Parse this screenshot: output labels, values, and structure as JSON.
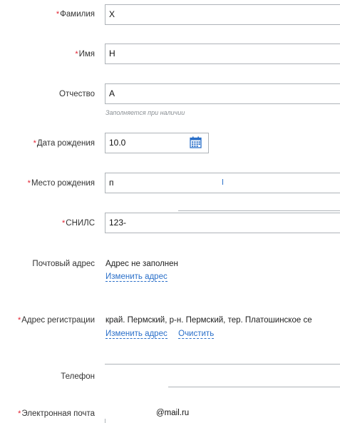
{
  "form": {
    "surname": {
      "label": "Фамилия",
      "required": "*",
      "value": "Х"
    },
    "name": {
      "label": "Имя",
      "required": "*",
      "value": "Н"
    },
    "patronymic": {
      "label": "Отчество",
      "value": "А",
      "hint": "Заполняется при наличии"
    },
    "birth_date": {
      "label": "Дата рождения",
      "required": "*",
      "value": "10.0"
    },
    "birth_place": {
      "label": "Место рождения",
      "required": "*",
      "value": "п"
    },
    "snils": {
      "label": "СНИЛС",
      "required": "*",
      "value": "123-"
    },
    "postal_address": {
      "label": "Почтовый адрес",
      "value": "Адрес не заполнен",
      "change_link": "Изменить адрес"
    },
    "registration_address": {
      "label": "Адрес регистрации",
      "required": "*",
      "value": "край. Пермский, р-н. Пермский, тер. Платошинское се",
      "change_link": "Изменить адрес",
      "clear_link": "Очистить"
    },
    "phone": {
      "label": "Телефон"
    },
    "email": {
      "label": "Электронная почта",
      "required": "*",
      "value": "@mail.ru"
    }
  },
  "colors": {
    "required_mark": "#e2202f",
    "link": "#2a6fc9",
    "border": "#aeb3b8",
    "hint": "#8a8f94"
  },
  "icons": {
    "calendar": "calendar-icon"
  }
}
